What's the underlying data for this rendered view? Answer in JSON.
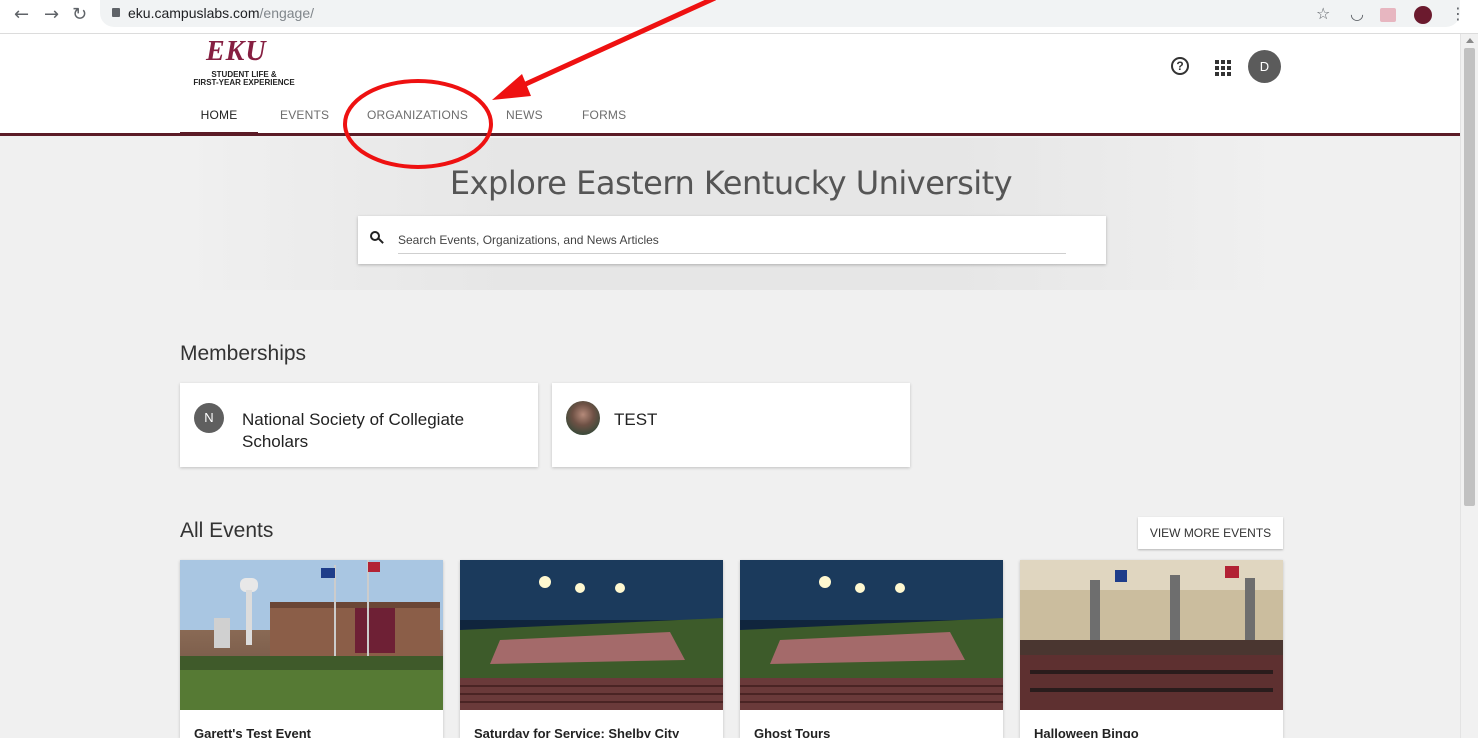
{
  "browser": {
    "url_host": "eku.campuslabs.com",
    "url_path": "/engage/",
    "colors": {
      "chrome": "#ffffff",
      "omnibox": "#f1f3f4"
    }
  },
  "site": {
    "logo_mark": "EKU",
    "logo_line1": "STUDENT LIFE &",
    "logo_line2": "FIRST-YEAR EXPERIENCE",
    "nav": {
      "home": "HOME",
      "events": "EVENTS",
      "organizations": "ORGANIZATIONS",
      "news": "NEWS",
      "forms": "FORMS"
    },
    "user_initial": "D",
    "brand_color": "#5b1b26"
  },
  "hero": {
    "title": "Explore Eastern Kentucky University",
    "search_placeholder": "Search Events, Organizations, and News Articles"
  },
  "memberships": {
    "title": "Memberships",
    "items": [
      {
        "initial": "N",
        "name_line1": "National Society of Collegiate",
        "name_line2": "Scholars"
      },
      {
        "initial": "",
        "name_line1": "TEST",
        "name_line2": ""
      }
    ]
  },
  "events": {
    "title": "All Events",
    "view_more": "VIEW MORE EVENTS",
    "items": [
      {
        "title": "Garett's Test Event"
      },
      {
        "title": "Saturday for Service: Shelby City"
      },
      {
        "title": "Ghost Tours"
      },
      {
        "title": "Halloween Bingo"
      }
    ]
  },
  "annotation": {
    "color": "#ee1111"
  }
}
